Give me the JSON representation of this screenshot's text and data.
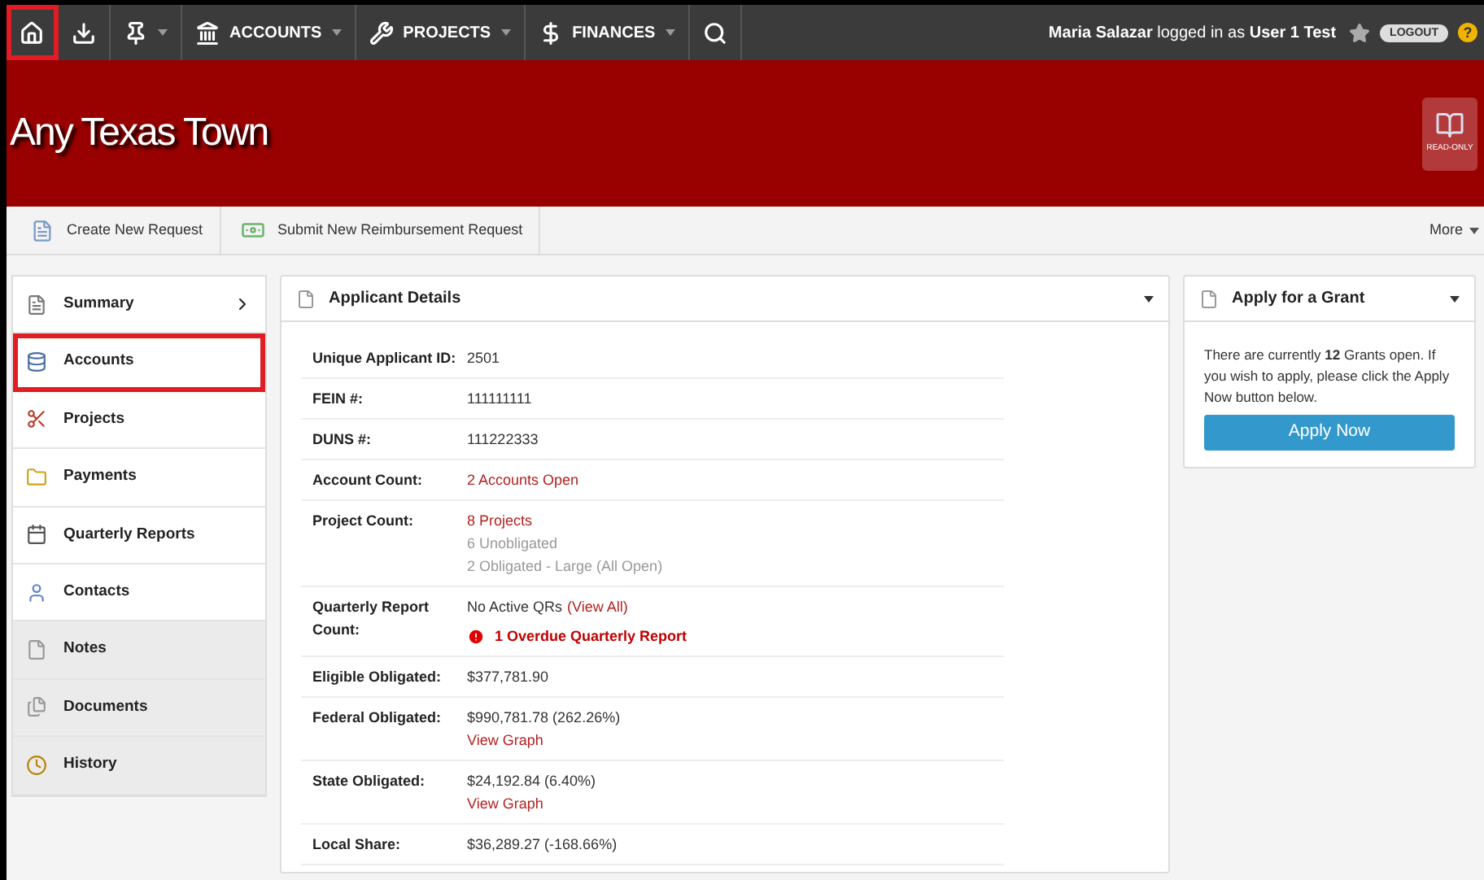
{
  "nav": {
    "items": [
      {
        "kind": "home",
        "caret": false,
        "highlighted": true
      },
      {
        "kind": "download",
        "caret": false,
        "highlighted": false
      },
      {
        "kind": "pin",
        "caret": true,
        "highlighted": false
      },
      {
        "kind": "bank",
        "label": "ACCOUNTS",
        "caret": true,
        "highlighted": false
      },
      {
        "kind": "wrench",
        "label": "PROJECTS",
        "caret": true,
        "highlighted": false
      },
      {
        "kind": "dollar",
        "label": "FINANCES",
        "caret": true,
        "highlighted": false
      },
      {
        "kind": "search",
        "caret": false,
        "highlighted": false
      }
    ],
    "user": "Maria Salazar",
    "logged_in_as": "logged in as",
    "account": "User 1 Test",
    "logout": "LOGOUT",
    "help": "?"
  },
  "banner": {
    "title": "Any Texas Town",
    "badge": "READ-ONLY"
  },
  "toolbar": {
    "actions": [
      {
        "kind": "new",
        "label": "Create New Request"
      },
      {
        "kind": "money",
        "label": "Submit New Reimbursement Request"
      }
    ],
    "more": "More"
  },
  "sidebar": {
    "items": [
      {
        "kind": "summary",
        "label": "Summary",
        "chevron": true,
        "highlighted": false,
        "shaded": false
      },
      {
        "kind": "accounts",
        "label": "Accounts",
        "chevron": false,
        "highlighted": true,
        "shaded": false
      },
      {
        "kind": "projects",
        "label": "Projects",
        "chevron": false,
        "highlighted": false,
        "shaded": false
      },
      {
        "kind": "payments",
        "label": "Payments",
        "chevron": false,
        "highlighted": false,
        "shaded": false
      },
      {
        "kind": "reports",
        "label": "Quarterly Reports",
        "chevron": false,
        "highlighted": false,
        "shaded": false
      },
      {
        "kind": "contacts",
        "label": "Contacts",
        "chevron": false,
        "highlighted": false,
        "shaded": false
      },
      {
        "kind": "notes",
        "label": "Notes",
        "chevron": false,
        "highlighted": false,
        "shaded": true
      },
      {
        "kind": "documents",
        "label": "Documents",
        "chevron": false,
        "highlighted": false,
        "shaded": true
      },
      {
        "kind": "history",
        "label": "History",
        "chevron": false,
        "highlighted": false,
        "shaded": true
      }
    ]
  },
  "details": {
    "title": "Applicant Details",
    "rows": [
      {
        "label": "Unique Applicant ID:",
        "lines": [
          [
            {
              "kind": "plain",
              "text": "2501"
            }
          ]
        ]
      },
      {
        "label": "FEIN #:",
        "lines": [
          [
            {
              "kind": "plain",
              "text": "111111111"
            }
          ]
        ]
      },
      {
        "label": "DUNS #:",
        "lines": [
          [
            {
              "kind": "plain",
              "text": "111222333"
            }
          ]
        ]
      },
      {
        "label": "Account Count:",
        "lines": [
          [
            {
              "kind": "link",
              "text": "2 Accounts Open"
            }
          ]
        ]
      },
      {
        "label": "Project Count:",
        "lines": [
          [
            {
              "kind": "link",
              "text": "8 Projects"
            }
          ],
          [
            {
              "kind": "muted",
              "text": "6 Unobligated"
            }
          ],
          [
            {
              "kind": "muted",
              "text": "2 Obligated - Large (All Open)"
            }
          ]
        ]
      },
      {
        "label": "Quarterly Report Count:",
        "lines": [
          [
            {
              "kind": "plain",
              "text": "No Active QRs"
            },
            {
              "kind": "link",
              "text": "(View All)"
            }
          ],
          [
            {
              "kind": "alert",
              "text": "1 Overdue Quarterly Report"
            }
          ]
        ]
      },
      {
        "label": "Eligible Obligated:",
        "lines": [
          [
            {
              "kind": "plain",
              "text": "$377,781.90"
            }
          ]
        ]
      },
      {
        "label": "Federal Obligated:",
        "lines": [
          [
            {
              "kind": "plain",
              "text": "$990,781.78 (262.26%)"
            }
          ],
          [
            {
              "kind": "link",
              "text": "View Graph"
            }
          ]
        ]
      },
      {
        "label": "State Obligated:",
        "lines": [
          [
            {
              "kind": "plain",
              "text": "$24,192.84 (6.40%)"
            }
          ],
          [
            {
              "kind": "link",
              "text": "View Graph"
            }
          ]
        ]
      },
      {
        "label": "Local Share:",
        "lines": [
          [
            {
              "kind": "plain",
              "text": "$36,289.27 (-168.66%)"
            }
          ]
        ]
      }
    ]
  },
  "grant": {
    "title": "Apply for a Grant",
    "text": "There are currently **12** Grants open. If you wish to apply, please click the Apply Now button below.",
    "button": "Apply Now"
  }
}
